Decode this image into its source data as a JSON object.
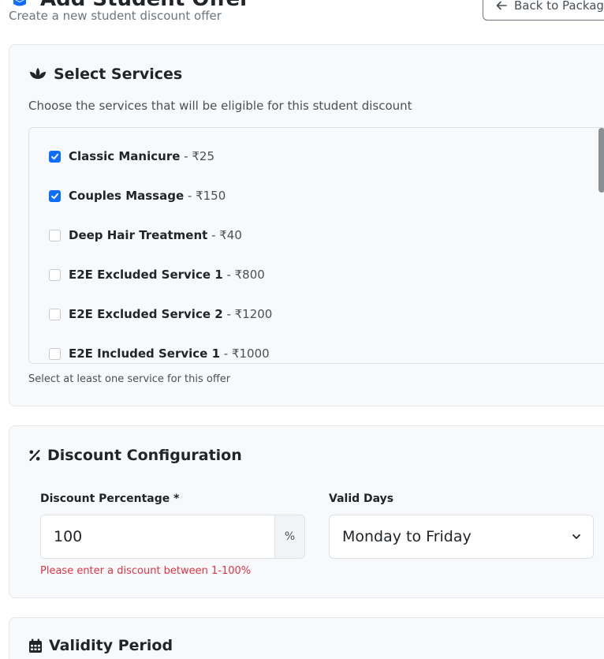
{
  "header": {
    "title": "Add Student Offer",
    "subtitle": "Create a new student discount offer",
    "back_label": "Back to Packages"
  },
  "services_section": {
    "title": "Select Services",
    "help": "Choose the services that will be eligible for this student discount",
    "items": [
      {
        "name": "Classic Manicure",
        "price": " - ₹25",
        "checked": true
      },
      {
        "name": "Couples Massage",
        "price": " - ₹150",
        "checked": true
      },
      {
        "name": "Deep Hair Treatment",
        "price": " - ₹40",
        "checked": false
      },
      {
        "name": "E2E Excluded Service 1",
        "price": " - ₹800",
        "checked": false
      },
      {
        "name": "E2E Excluded Service 2",
        "price": " - ₹1200",
        "checked": false
      },
      {
        "name": "E2E Included Service 1",
        "price": " - ₹1000",
        "checked": false
      }
    ],
    "footer": "Select at least one service for this offer"
  },
  "discount_section": {
    "title": "Discount Configuration",
    "percentage_label": "Discount Percentage *",
    "percentage_value": "100",
    "percentage_addon": "%",
    "error": "Please enter a discount between 1-100%",
    "valid_days_label": "Valid Days",
    "valid_days_value": "Monday to Friday"
  },
  "validity_section": {
    "title": "Validity Period"
  },
  "colors": {
    "accent": "#0d6efd",
    "error": "#dc3545"
  }
}
